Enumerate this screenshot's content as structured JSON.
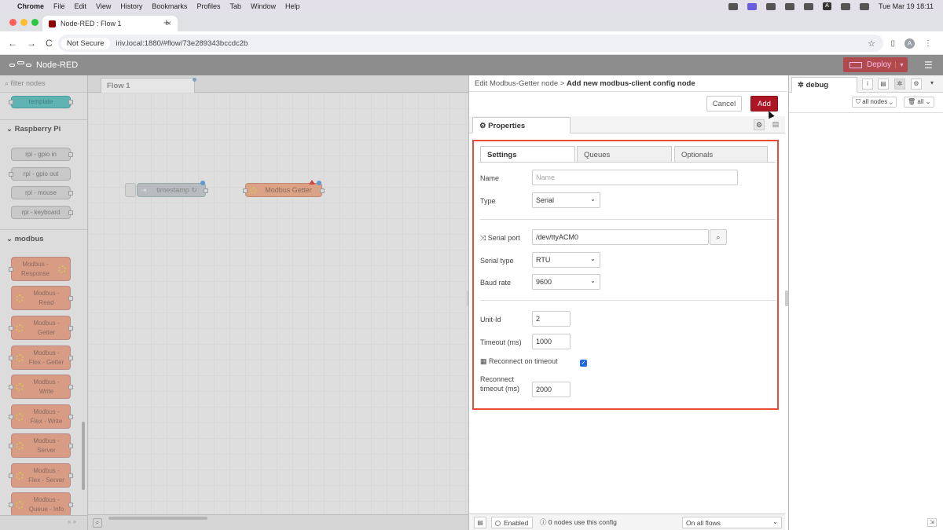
{
  "macos": {
    "apple": "",
    "app": "Chrome",
    "menus": [
      "File",
      "Edit",
      "View",
      "History",
      "Bookmarks",
      "Profiles",
      "Tab",
      "Window",
      "Help"
    ],
    "input_indicator": "A",
    "clock": "Tue Mar 19  18:11"
  },
  "browser": {
    "tab_title": "Node-RED : Flow 1",
    "tab_close": "×",
    "new_tab": "+",
    "back": "←",
    "forward": "→",
    "reload": "C",
    "security_label": "Not Secure",
    "url": "iriv.local:1880/#flow/73e289343bccdc2b",
    "star": "☆",
    "profile_initial": "A",
    "more": "⋮"
  },
  "nodered": {
    "title": "Node-RED",
    "deploy_label": "Deploy",
    "deploy_caret": "▾",
    "menu_icon": "☰"
  },
  "palette": {
    "filter_placeholder": "filter nodes",
    "top_node": "template",
    "categories": {
      "raspberry": "Raspberry Pi",
      "modbus": "modbus"
    },
    "rpi_nodes": [
      "rpi - gpio in",
      "rpi - gpio out",
      "rpi - mouse",
      "rpi - keyboard"
    ],
    "modbus_nodes": [
      [
        "Modbus -",
        "Response"
      ],
      [
        "Modbus -",
        "Read"
      ],
      [
        "Modbus -",
        "Getter"
      ],
      [
        "Modbus -",
        "Flex - Getter"
      ],
      [
        "Modbus -",
        "Write"
      ],
      [
        "Modbus -",
        "Flex - Write"
      ],
      [
        "Modbus -",
        "Server"
      ],
      [
        "Modbus -",
        "Flex - Server"
      ],
      [
        "Modbus -",
        "Queue - Info"
      ]
    ]
  },
  "workspace": {
    "tab": "Flow 1",
    "nodes": {
      "timestamp": "timestamp ↻",
      "getter": "Modbus Getter"
    }
  },
  "editor": {
    "breadcrumb_parent": "Edit Modbus-Getter node",
    "breadcrumb_sep": ">",
    "breadcrumb_current": "Add new modbus-client config node",
    "cancel_label": "Cancel",
    "add_label": "Add",
    "properties_tab": "Properties",
    "subtabs": [
      "Settings",
      "Queues",
      "Optionals"
    ],
    "fields": {
      "name_label": "Name",
      "name_placeholder": "Name",
      "type_label": "Type",
      "type_value": "Serial",
      "serial_port_label": "Serial port",
      "serial_port_value": "/dev/ttyACM0",
      "serial_type_label": "Serial type",
      "serial_type_value": "RTU",
      "baud_label": "Baud rate",
      "baud_value": "9600",
      "unit_id_label": "Unit-Id",
      "unit_id_value": "2",
      "timeout_label": "Timeout (ms)",
      "timeout_value": "1000",
      "reconnect_label": "Reconnect on timeout",
      "reconnect_checked": true,
      "reconnect_timeout_label_1": "Reconnect",
      "reconnect_timeout_label_2": "timeout (ms)",
      "reconnect_timeout_value": "2000"
    },
    "footer": {
      "enabled_label": "Enabled",
      "use_count": "0 nodes use this config",
      "scope": "On all flows"
    }
  },
  "sidebar": {
    "tab": "debug",
    "filter_nodes": "all nodes",
    "filter_all": "all"
  }
}
